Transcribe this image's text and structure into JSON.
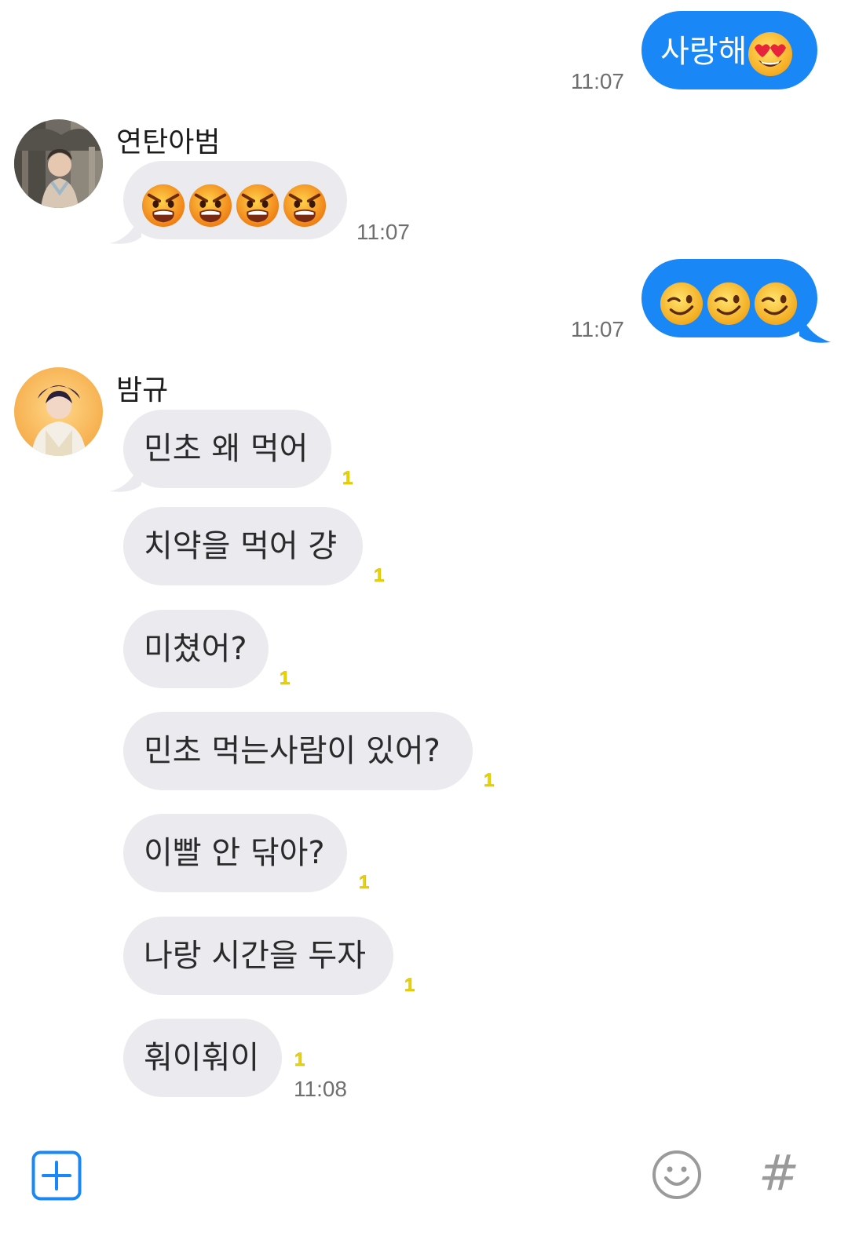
{
  "messages": [
    {
      "id": "m1",
      "direction": "outgoing",
      "text": "사랑해",
      "emoji": [
        "heart-eyes-face"
      ],
      "time": "11:07"
    },
    {
      "id": "m2",
      "direction": "incoming",
      "sender": "연탄아범",
      "text": "",
      "emoji": [
        "angry-face",
        "angry-face",
        "angry-face",
        "angry-face"
      ],
      "time": "11:07"
    },
    {
      "id": "m3",
      "direction": "outgoing",
      "text": "",
      "emoji": [
        "winking-face",
        "winking-face",
        "winking-face"
      ],
      "time": "11:07"
    },
    {
      "id": "m4",
      "direction": "incoming",
      "sender": "밤규",
      "text": "민초 왜 먹어",
      "unread": "1"
    },
    {
      "id": "m5",
      "direction": "incoming",
      "text": "치약을 먹어 걍",
      "unread": "1"
    },
    {
      "id": "m6",
      "direction": "incoming",
      "text": "미쳤어?",
      "unread": "1"
    },
    {
      "id": "m7",
      "direction": "incoming",
      "text": "민초 먹는사람이 있어?",
      "unread": "1"
    },
    {
      "id": "m8",
      "direction": "incoming",
      "text": "이빨 안 닦아?",
      "unread": "1"
    },
    {
      "id": "m9",
      "direction": "incoming",
      "text": "나랑 시간을 두자",
      "unread": "1"
    },
    {
      "id": "m10",
      "direction": "incoming",
      "text": "훠이훠이",
      "unread": "1",
      "time": "11:08"
    }
  ],
  "toolbar": {
    "add_icon": "plus-square-icon",
    "emoji_icon": "smiley-icon",
    "hashtag_icon": "hashtag-icon",
    "hashtag_glyph": "#"
  },
  "colors": {
    "outgoing_bubble": "#1a87f7",
    "incoming_bubble": "#ebebef",
    "unread_badge": "#e9d400",
    "accent": "#1a87f7"
  }
}
